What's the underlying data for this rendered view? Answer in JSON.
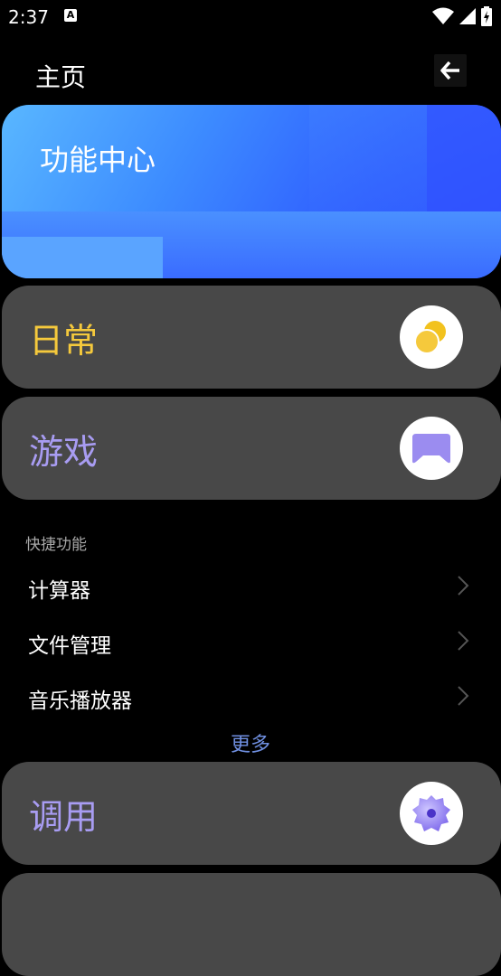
{
  "status": {
    "time": "2:37",
    "notice_glyph": "A"
  },
  "header": {
    "title": "主页"
  },
  "banner": {
    "title": "功能中心"
  },
  "cards": [
    {
      "label": "日常",
      "color": "#f5c93c",
      "icon": "coins-icon"
    },
    {
      "label": "游戏",
      "color": "#a89cf2",
      "icon": "gamepad-icon"
    },
    {
      "label": "调用",
      "color": "#a89cf2",
      "icon": "gear-blob-icon"
    }
  ],
  "shortcuts": {
    "label": "快捷功能",
    "items": [
      {
        "label": "计算器"
      },
      {
        "label": "文件管理"
      },
      {
        "label": "音乐播放器"
      }
    ],
    "more_label": "更多"
  },
  "colors": {
    "card_bg": "#484848",
    "accent_blue": "#6f8fe0",
    "daily_yellow": "#f5c93c",
    "purple": "#a89cf2"
  }
}
